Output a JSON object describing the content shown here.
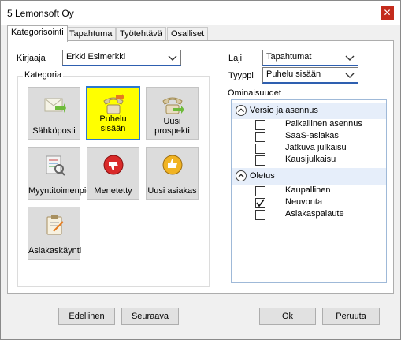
{
  "window": {
    "title": "5 Lemonsoft Oy",
    "close_glyph": "✕"
  },
  "tabs": [
    {
      "label": "Kategorisointi",
      "active": true
    },
    {
      "label": "Tapahtuma",
      "active": false
    },
    {
      "label": "Työtehtävä",
      "active": false
    },
    {
      "label": "Osalliset",
      "active": false
    }
  ],
  "fields": {
    "kirjaaja": {
      "label": "Kirjaaja",
      "value": "Erkki Esimerkki"
    },
    "laji": {
      "label": "Laji",
      "value": "Tapahtumat"
    },
    "tyyppi": {
      "label": "Tyyppi",
      "value": "Puhelu sisään"
    }
  },
  "kategoria": {
    "title": "Kategoria",
    "tiles": [
      {
        "label": "Sähköposti",
        "icon": "email-icon",
        "selected": false
      },
      {
        "label": "Puhelu sisään",
        "icon": "phone-incoming-icon",
        "selected": true
      },
      {
        "label": "Uusi prospekti",
        "icon": "phone-prospect-icon",
        "selected": false
      },
      {
        "label": "Myyntitoimenpide",
        "icon": "sales-action-icon",
        "selected": false
      },
      {
        "label": "Menetetty",
        "icon": "thumbs-down-icon",
        "selected": false
      },
      {
        "label": "Uusi asiakas",
        "icon": "thumbs-up-icon",
        "selected": false
      },
      {
        "label": "Asiakaskäynti",
        "icon": "clipboard-icon",
        "selected": false
      }
    ]
  },
  "ominaisuudet": {
    "title": "Ominaisuudet",
    "groups": [
      {
        "title": "Versio ja asennus",
        "items": [
          {
            "label": "Paikallinen asennus",
            "checked": false
          },
          {
            "label": "SaaS-asiakas",
            "checked": false
          },
          {
            "label": "Jatkuva julkaisu",
            "checked": false
          },
          {
            "label": "Kausijulkaisu",
            "checked": false
          }
        ]
      },
      {
        "title": "Oletus",
        "items": [
          {
            "label": "Kaupallinen",
            "checked": false
          },
          {
            "label": "Neuvonta",
            "checked": true
          },
          {
            "label": "Asiakaspalaute",
            "checked": false
          }
        ]
      }
    ]
  },
  "buttons": {
    "previous": "Edellinen",
    "next": "Seuraava",
    "ok": "Ok",
    "cancel": "Peruuta"
  },
  "colors": {
    "selected_tile": "#ffff00",
    "selected_border": "#2b78d0",
    "close": "#c42b1c"
  }
}
